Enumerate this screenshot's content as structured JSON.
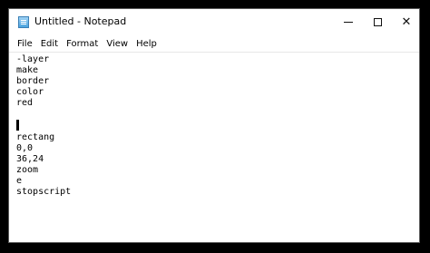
{
  "window": {
    "title": "Untitled - Notepad"
  },
  "menu": {
    "items": [
      "File",
      "Edit",
      "Format",
      "View",
      "Help"
    ]
  },
  "editor": {
    "lines": [
      "-layer",
      "make",
      "border",
      "color",
      "red",
      "",
      "rectang",
      "0,0",
      "36,24",
      "zoom",
      "e",
      "stopscript"
    ]
  },
  "icons": {
    "app": "notepad-icon",
    "minimize": "minimize-icon",
    "maximize": "maximize-icon",
    "close": "close-icon"
  }
}
